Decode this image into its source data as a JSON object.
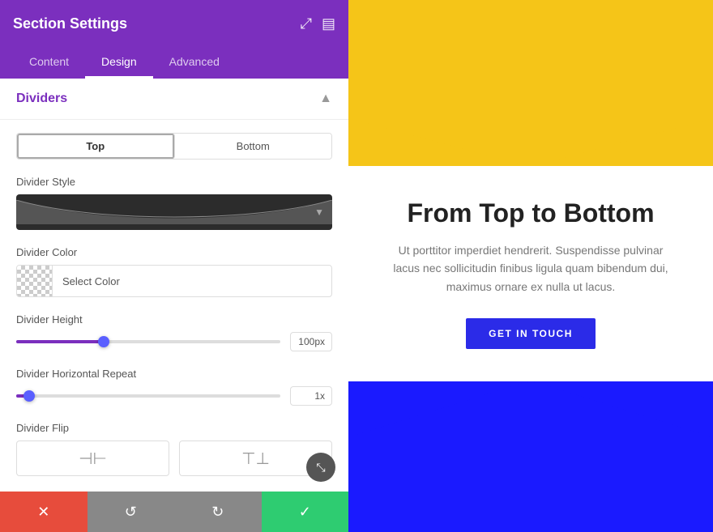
{
  "panel": {
    "title": "Section Settings",
    "tabs": [
      {
        "id": "content",
        "label": "Content"
      },
      {
        "id": "design",
        "label": "Design",
        "active": true
      },
      {
        "id": "advanced",
        "label": "Advanced"
      }
    ],
    "section": {
      "title": "Dividers",
      "toggle": {
        "top_label": "Top",
        "bottom_label": "Bottom"
      },
      "divider_style_label": "Divider Style",
      "divider_color_label": "Divider Color",
      "select_color_label": "Select Color",
      "divider_height_label": "Divider Height",
      "divider_height_value": "100px",
      "divider_height_percent": 33,
      "divider_repeat_label": "Divider Horizontal Repeat",
      "divider_repeat_value": "1x",
      "divider_repeat_percent": 5,
      "divider_flip_label": "Divider Flip",
      "flip_horizontal_icon": "⊣⊢",
      "flip_vertical_icon": "⊤⊥"
    },
    "actions": {
      "cancel_icon": "✕",
      "undo_icon": "↺",
      "redo_icon": "↻",
      "save_icon": "✓"
    }
  },
  "preview": {
    "heading": "From Top to Bottom",
    "body": "Ut porttitor imperdiet hendrerit. Suspendisse pulvinar lacus nec sollicitudin finibus ligula quam bibendum dui, maximus ornare ex nulla ut lacus.",
    "cta_label": "GET IN TOUCH",
    "top_bg": "#f5c518",
    "bottom_bg": "#1a1aff"
  }
}
